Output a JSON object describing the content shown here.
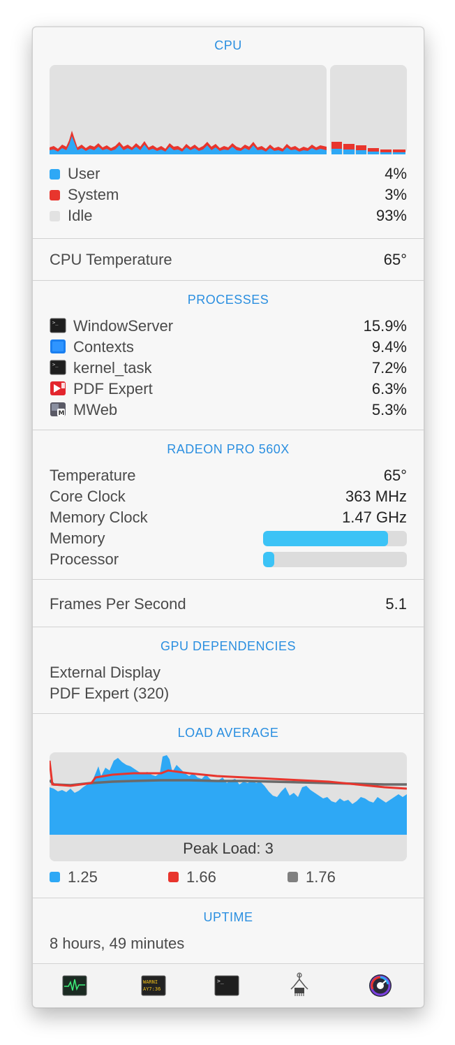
{
  "cpu": {
    "title": "CPU",
    "rows": [
      {
        "label": "User",
        "value": "4%",
        "color": "#2ea8f5"
      },
      {
        "label": "System",
        "value": "3%",
        "color": "#e8352d"
      },
      {
        "label": "Idle",
        "value": "93%",
        "color": "#e2e2e2"
      }
    ]
  },
  "cpu_temp": {
    "label": "CPU Temperature",
    "value": "65°"
  },
  "processes": {
    "title": "PROCESSES",
    "items": [
      {
        "name": "WindowServer",
        "value": "15.9%",
        "icon": "terminal-icon"
      },
      {
        "name": "Contexts",
        "value": "9.4%",
        "icon": "contexts-app-icon"
      },
      {
        "name": "kernel_task",
        "value": "7.2%",
        "icon": "terminal-icon"
      },
      {
        "name": "PDF Expert",
        "value": "6.3%",
        "icon": "pdf-expert-icon"
      },
      {
        "name": "MWeb",
        "value": "5.3%",
        "icon": "mweb-icon"
      }
    ]
  },
  "gpu": {
    "title": "RADEON PRO 560X",
    "temperature": {
      "label": "Temperature",
      "value": "65°"
    },
    "core_clock": {
      "label": "Core Clock",
      "value": "363 MHz"
    },
    "memory_clock": {
      "label": "Memory Clock",
      "value": "1.47 GHz"
    },
    "memory": {
      "label": "Memory",
      "level": 0.87
    },
    "processor": {
      "label": "Processor",
      "level": 0.08
    }
  },
  "fps": {
    "label": "Frames Per Second",
    "value": "5.1"
  },
  "gpu_dependencies": {
    "title": "GPU DEPENDENCIES",
    "items": [
      "External Display",
      "PDF Expert (320)"
    ]
  },
  "load_average": {
    "title": "LOAD AVERAGE",
    "peak_label": "Peak Load: 3",
    "legend": [
      {
        "value": "1.25",
        "color": "#2ea8f5"
      },
      {
        "value": "1.66",
        "color": "#e8352d"
      },
      {
        "value": "1.76",
        "color": "#808080"
      }
    ]
  },
  "uptime": {
    "title": "UPTIME",
    "value": "8 hours, 49 minutes"
  },
  "toolbar": {
    "items": [
      "activity-monitor-icon",
      "console-icon",
      "terminal-icon",
      "system-information-icon",
      "istat-menus-icon"
    ]
  }
}
